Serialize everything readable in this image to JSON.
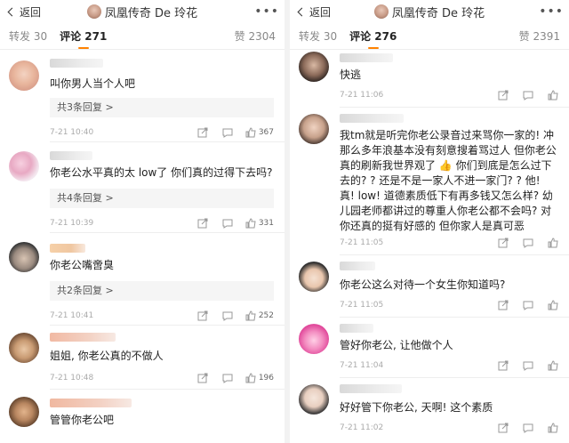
{
  "left": {
    "back_label": "返回",
    "title": "凤凰传奇 De 玲花",
    "more_label": "•••",
    "tabs": {
      "repost": "转发 30",
      "comment": "评论 271",
      "like": "赞 2304"
    },
    "comments": [
      {
        "text": "叫你男人当个人吧",
        "replies": "共3条回复 >",
        "time": "7-21 10:40",
        "likes": "367"
      },
      {
        "text": "你老公水平真的太 low了 你们真的过得下去吗?",
        "replies": "共4条回复 >",
        "time": "7-21 10:39",
        "likes": "331"
      },
      {
        "text": "你老公嘴啻臭",
        "replies": "共2条回复 >",
        "time": "7-21 10:41",
        "likes": "252"
      },
      {
        "text": "姐姐, 你老公真的不做人",
        "replies": "",
        "time": "7-21 10:48",
        "likes": "196"
      },
      {
        "text": "管管你老公吧",
        "replies": "",
        "time": "",
        "likes": ""
      }
    ]
  },
  "right": {
    "back_label": "返回",
    "title": "凤凰传奇 De 玲花",
    "more_label": "•••",
    "tabs": {
      "repost": "转发 30",
      "comment": "评论 276",
      "like": "赞 2391"
    },
    "comments": [
      {
        "text": "快逃",
        "time": "7-21 11:06"
      },
      {
        "text": "我tm就是听完你老公录音过来骂你一家的! 冲那么多年浪基本没有刻意搜着骂过人 但你老公真的刷新我世界观了 👍 你们到底是怎么过下去的? ? 还是不是一家人不进一家门? ? 他! 真! low! 道德素质低下有再多钱又怎么样? 幼儿园老师都讲过的尊重人你老公都不会吗? 对你还真的挺有好感的 但你家人是真可恶",
        "time": "7-21 11:05"
      },
      {
        "text": "你老公这么对待一个女生你知道吗?",
        "time": "7-21 11:05"
      },
      {
        "text": "管好你老公, 让他做个人",
        "time": "7-21 11:04"
      },
      {
        "text": "好好管下你老公, 天啊! 这个素质",
        "time": "7-21 11:02"
      }
    ]
  },
  "icons": [
    "chevron-left-icon",
    "share-icon",
    "comment-icon",
    "like-icon"
  ],
  "colors": {
    "accent": "#ff8200",
    "reply_bg": "#f5f5f5",
    "meta_text": "#aaaaaa"
  }
}
